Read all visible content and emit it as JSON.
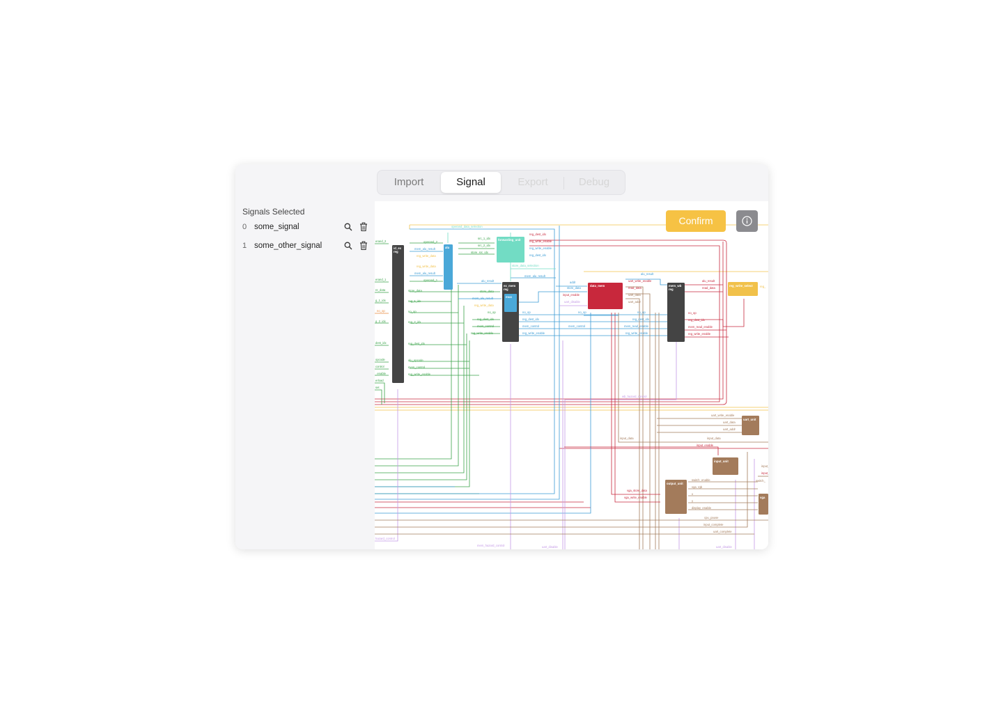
{
  "tabs": [
    {
      "label": "Import",
      "state": "normal"
    },
    {
      "label": "Signal",
      "state": "active"
    },
    {
      "label": "Export",
      "state": "disabled"
    },
    {
      "label": "Debug",
      "state": "disabled"
    }
  ],
  "sidebar": {
    "title": "Signals Selected",
    "signals": [
      {
        "index": "0",
        "name": "some_signal"
      },
      {
        "index": "1",
        "name": "some_other_signal"
      }
    ]
  },
  "toolbar": {
    "confirm_label": "Confirm",
    "info_icon": "info-icon"
  },
  "colors": {
    "accent": "#f6c244",
    "block_dark": "#444444",
    "forwarding_unit": "#72dcc4",
    "alu": "#4aa8d8",
    "data_mem": "#c8283c",
    "io_unit": "#a37b5b",
    "green": "#3aa34a",
    "blue": "#3a9bd5",
    "red": "#c8283c",
    "orange": "#e8893a",
    "purple": "#c49ae6",
    "brown": "#a37b5b",
    "yellow": "#f1c14a"
  },
  "diagram": {
    "blocks": {
      "id_ex_reg": "id_ex\nreg",
      "alu": "alu",
      "forwarding_unit": "forwarding_unit",
      "ex_mem_reg": "ex_mem\nreg",
      "mux": "mux",
      "data_mem": "data_mem",
      "mem_wb_reg": "mem_wb\nreg",
      "reg_write_select": "reg_write_select",
      "uart_unit": "uart_unit",
      "input_unit": "input_unit",
      "output_unit": "output_unit",
      "vga": "vga"
    },
    "signal_labels": {
      "left_edge": [
        "erand_2",
        "erand_1",
        "re_data",
        "g_1_idx",
        "no_op",
        "g_2_idx",
        "dest_idx",
        "opcode",
        "control",
        "_enable",
        "erload",
        "set",
        "hazard_control"
      ],
      "id_ex_out": [
        "operand_2",
        "mem_alu_result",
        "reg_write_data",
        "reg_write_data",
        "mem_alu_result",
        "operand_1",
        "store_data",
        "reg_1_idx",
        "no_op",
        "reg_2_idx",
        "reg_dest_idx",
        "alu_opcode",
        "mem_control",
        "reg_write_enable"
      ],
      "forwarding": [
        "operand_data_selection",
        "src_1_idx",
        "src_2_idx",
        "store_src_idx",
        "reg_dest_idx",
        "reg_write_enable",
        "reg_write_enable",
        "reg_dest_idx",
        "store_data_selection"
      ],
      "ex_mem_in": [
        "alu_result",
        "store_data",
        "mem_alu_result",
        "reg_write_data",
        "no_op",
        "reg_dest_idx",
        "mem_control",
        "reg_write_enable",
        "mem_alu_result"
      ],
      "ex_mem_out": [
        "no_op",
        "reg_dest_idx",
        "mem_control",
        "reg_write_enable"
      ],
      "data_mem_in": [
        "addr",
        "store_data",
        "input_enable",
        "uart_disable",
        "no_op",
        "mem_control"
      ],
      "data_mem_out": [
        "alu_result",
        "uart_write_enable",
        "read_data",
        "uart_data",
        "uart_addr",
        "no_op",
        "reg_dest_idx",
        "mem_read_enable",
        "reg_write_enable"
      ],
      "mem_wb_out": [
        "alu_result",
        "read_data",
        "no_op",
        "reg_dest_idx",
        "mem_read_enable",
        "reg_write_enable",
        "reg_"
      ],
      "io": [
        "wb_hazard_control",
        "uart_write_enable",
        "uart_data",
        "uart_addr",
        "input_data",
        "input_data",
        "input_enable",
        "switch_enable",
        "vga_rgb",
        "x",
        "y",
        "display_enable",
        "vga_store_data",
        "vga_write_enable",
        "cpu_pause",
        "input_complete",
        "uart_complete",
        "uart_disable",
        "uart_disable",
        "mem_hazard_control",
        "input_",
        "input_",
        "switch_"
      ]
    }
  }
}
